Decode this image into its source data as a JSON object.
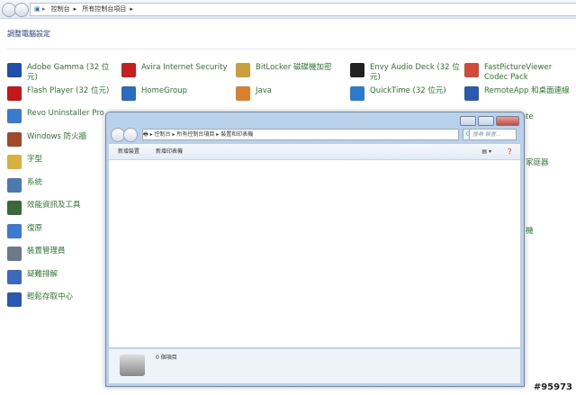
{
  "address": {
    "crumbs": [
      "控制台",
      "所有控制台項目"
    ]
  },
  "heading": "調整電腦設定",
  "items": [
    {
      "label": "Adobe Gamma (32 位元)",
      "color": "#1f4fa8"
    },
    {
      "label": "Avira Internet Security",
      "color": "#c81e1e"
    },
    {
      "label": "BitLocker 磁碟機加密",
      "color": "#c9a040"
    },
    {
      "label": "Envy Audio Deck (32 位元)",
      "color": "#222"
    },
    {
      "label": "FastPictureViewer Codec Pack",
      "color": "#d04a3a"
    },
    {
      "label": "Flash Player (32 位元)",
      "color": "#c41818"
    },
    {
      "label": "HomeGroup",
      "color": "#2a6bc4"
    },
    {
      "label": "Java",
      "color": "#d88030"
    },
    {
      "label": "QuickTime (32 位元)",
      "color": "#2a7ad0"
    },
    {
      "label": "RemoteApp 和桌面連線",
      "color": "#2a5ab0"
    },
    {
      "label": "Revo Uninstaller Pro",
      "color": "#3a7ad0"
    },
    {
      "label": "Windows 防火牆",
      "color": "#a04a2a"
    },
    {
      "label": "字型",
      "color": "#d8b040"
    },
    {
      "label": "系統",
      "color": "#4a7ab0"
    },
    {
      "label": "效能資訊及工具",
      "color": "#3a6a3a"
    },
    {
      "label": "復原",
      "color": "#3a7ad0"
    },
    {
      "label": "裝置管理員",
      "color": "#6a7a8a"
    },
    {
      "label": "疑難排解",
      "color": "#3a6ac0"
    },
    {
      "label": "輕鬆存取中心",
      "color": "#2a5ab0"
    }
  ],
  "partial": {
    "update": "pdate",
    "r2": "家庭器",
    "r3": "機"
  },
  "window": {
    "crumbs": [
      "控制台",
      "所有控制台項目",
      "裝置和印表機"
    ],
    "search_placeholder": "搜尋 裝置...",
    "toolbar": [
      "新增裝置",
      "新增印表機"
    ],
    "status": "0 個項目"
  },
  "stamp": "#95973"
}
